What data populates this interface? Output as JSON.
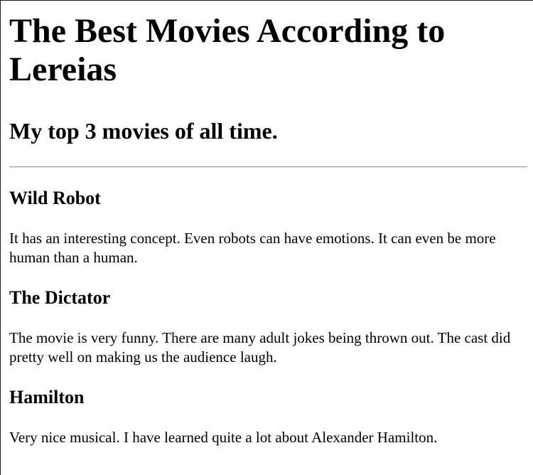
{
  "header": {
    "title": "The Best Movies According to Lereias",
    "subtitle": "My top 3 movies of all time."
  },
  "movies": [
    {
      "title": "Wild Robot",
      "review": "It has an interesting concept. Even robots can have emotions. It can even be more human than a human."
    },
    {
      "title": "The Dictator",
      "review": "The movie is very funny. There are many adult jokes being thrown out. The cast did pretty well on making us the audience laugh."
    },
    {
      "title": "Hamilton",
      "review": "Very nice musical. I have learned quite a lot about Alexander Hamilton."
    }
  ]
}
